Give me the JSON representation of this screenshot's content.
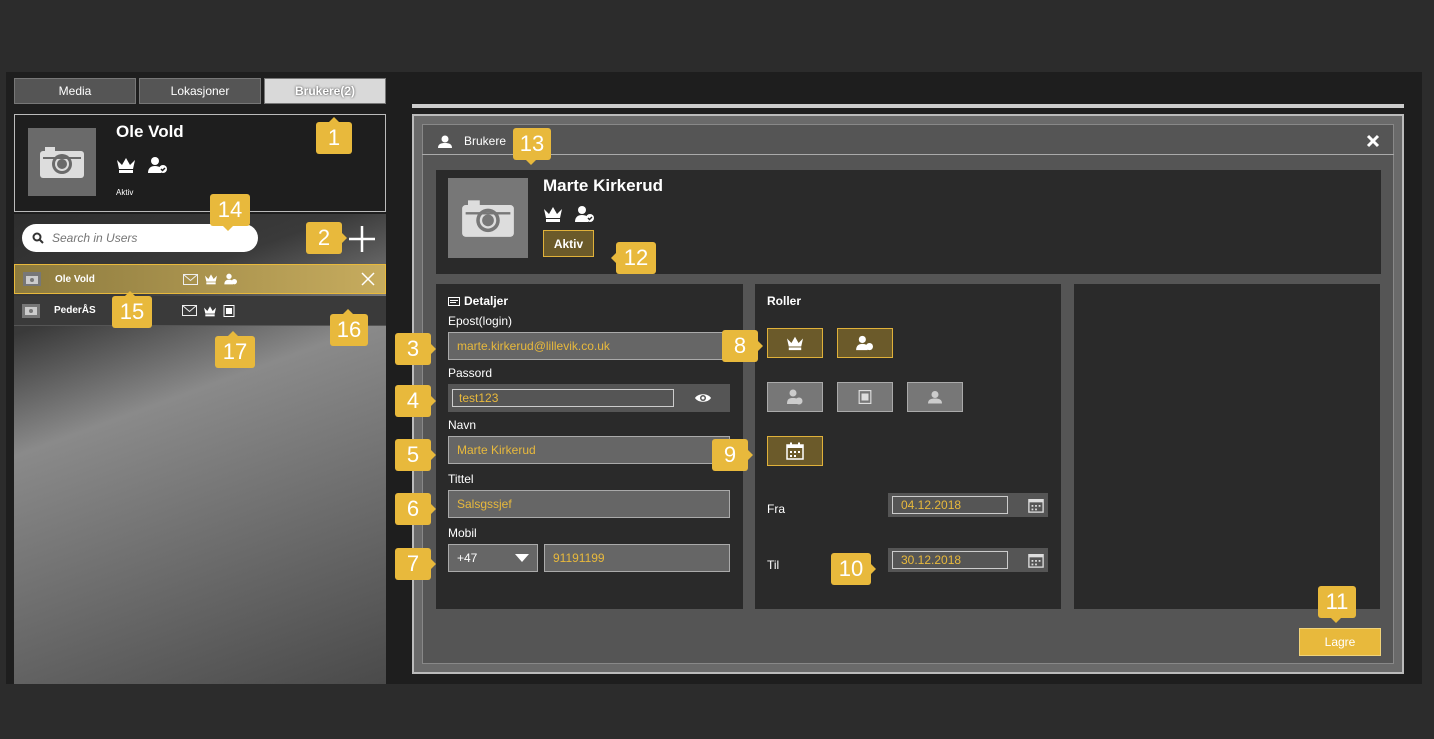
{
  "tabs": [
    {
      "label": "Media"
    },
    {
      "label": "Lokasjoner"
    },
    {
      "label": "Brukere(2)"
    }
  ],
  "profile": {
    "name": "Ole Vold",
    "status": "Aktiv"
  },
  "search": {
    "placeholder": "Search in Users"
  },
  "users": [
    {
      "name": "Ole Vold",
      "icons": [
        "mail-icon",
        "crown-icon",
        "user-shield-icon"
      ]
    },
    {
      "name": "PederÅS",
      "icons": [
        "mail-icon",
        "crown-icon",
        "contact-book-icon"
      ]
    }
  ],
  "dialog": {
    "title": "Brukere",
    "user_name": "Marte Kirkerud",
    "status_button": "Aktiv",
    "details_header": "Detaljer",
    "email_label": "Epost(login)",
    "email_value": "marte.kirkerud@lillevik.co.uk",
    "password_label": "Passord",
    "password_value": "test123",
    "name_label": "Navn",
    "name_value": "Marte Kirkerud",
    "title_label": "Tittel",
    "title_value": "Salsgssjef",
    "mobile_label": "Mobil",
    "country_code": "+47",
    "mobile_value": "91191199",
    "roles_header": "Roller",
    "from_label": "Fra",
    "from_value": "04.12.2018",
    "to_label": "Til",
    "to_value": "30.12.2018",
    "save_button": "Lagre"
  },
  "badges": [
    "1",
    "2",
    "3",
    "4",
    "5",
    "6",
    "7",
    "8",
    "9",
    "10",
    "11",
    "12",
    "13",
    "14",
    "15",
    "16",
    "17"
  ],
  "colors": {
    "accent": "#e8b93c",
    "background": "#2c2c2c",
    "panel": "#2a2a2a"
  }
}
